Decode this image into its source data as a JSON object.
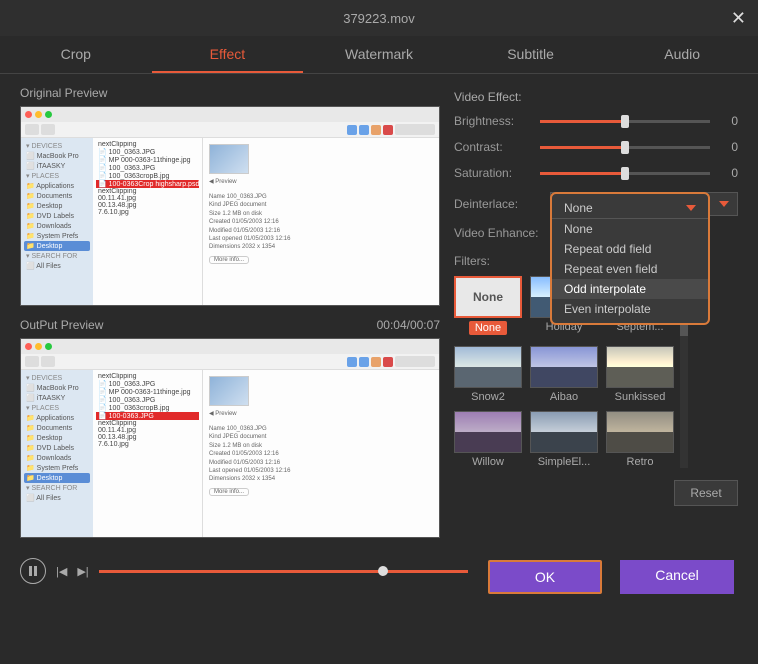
{
  "title": "379223.mov",
  "tabs": [
    "Crop",
    "Effect",
    "Watermark",
    "Subtitle",
    "Audio"
  ],
  "activeTab": 1,
  "previews": {
    "original_label": "Original Preview",
    "output_label": "OutPut Preview",
    "timecode": "00:04/00:07"
  },
  "panel": {
    "heading": "Video Effect:",
    "brightness_label": "Brightness:",
    "brightness_value": "0",
    "contrast_label": "Contrast:",
    "contrast_value": "0",
    "saturation_label": "Saturation:",
    "saturation_value": "0",
    "deinterlace_label": "Deinterlace:",
    "deinterlace_value": "None",
    "videoenhance_label": "Video Enhance:",
    "deinterlace_options": [
      "None",
      "Repeat odd field",
      "Repeat even field",
      "Odd interpolate",
      "Even interpolate"
    ],
    "filters_label": "Filters:",
    "filters": [
      "None",
      "Holiday",
      "Septem...",
      "Snow2",
      "Aibao",
      "Sunkissed",
      "Willow",
      "SimpleEl...",
      "Retro"
    ],
    "selected_filter": "None",
    "reset": "Reset"
  },
  "footer": {
    "ok": "OK",
    "cancel": "Cancel"
  }
}
